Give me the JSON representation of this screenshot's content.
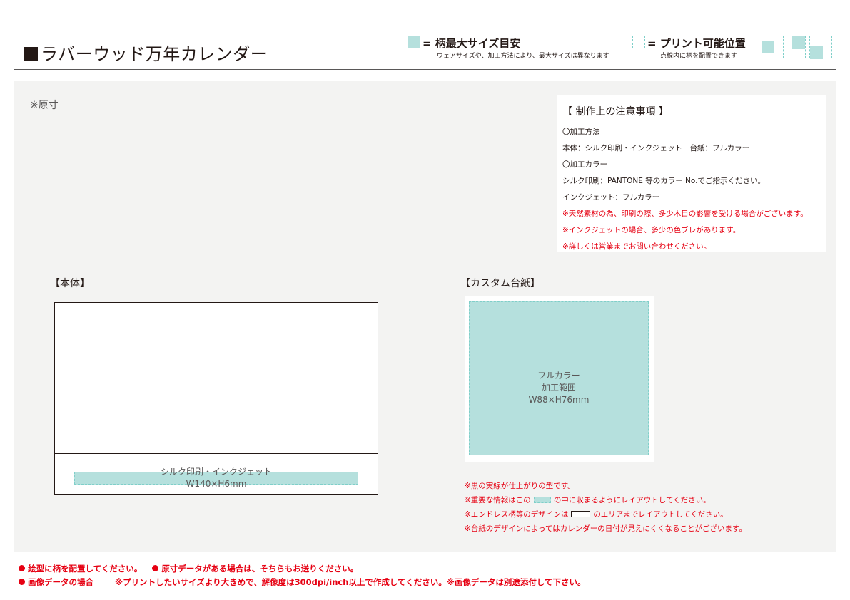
{
  "header": {
    "title": "ラバーウッド万年カレンダー",
    "legend_max": {
      "label": "= 柄最大サイズ目安",
      "sub": "ウェアサイズや、加工方法により、最大サイズは異なります"
    },
    "legend_position": {
      "label": "= プリント可能位置",
      "sub": "点線内に柄を配置できます"
    }
  },
  "main": {
    "scale_note": "※原寸",
    "notes": {
      "title": "【 制作上の注意事項 】",
      "lines": [
        "〇加工方法",
        "本体：シルク印刷・インクジェット　台紙：フルカラー",
        "〇加工カラー",
        "シルク印刷：PANTONE 等のカラー No.でご指示ください。",
        "インクジェット：フルカラー"
      ],
      "red_lines": [
        "※天然素材の為、印刷の際、多少木目の影響を受ける場合がございます。",
        "※インクジェットの場合、多少の色ブレがあります。",
        "※詳しくは営業までお問い合わせください。"
      ]
    },
    "body": {
      "label": "【本体】",
      "print_line1": "シルク印刷・インクジェット",
      "print_line2": "W140×H6mm"
    },
    "card": {
      "label": "【カスタム台紙】",
      "print_line1": "フルカラー",
      "print_line2": "加工範囲",
      "print_line3": "W88×H76mm",
      "note1": "※黒の実線が仕上がりの型です。",
      "note2_a": "※重要な情報はこの",
      "note2_b": "の中に収まるようにレイアウトしてください。",
      "note3_a": "※エンドレス柄等のデザインは",
      "note3_b": "のエリアまでレイアウトしてください。",
      "note4": "※台紙のデザインによってはカレンダーの日付が見えにくくなることがございます。"
    }
  },
  "footer": {
    "line1_a": "絵型に柄を配置してください。",
    "line1_b": "原寸データがある場合は、そちらもお送りください。",
    "line2_a": "画像データの場合",
    "line2_b": "※プリントしたいサイズより大きめで、解像度は300dpi/inch以上で作成してください。※画像データは別途添付して下さい。"
  },
  "colors": {
    "print_area": "#b5e0dd",
    "print_area_border": "#7fcfc9",
    "warning_red": "#e60012",
    "text": "#231815",
    "panel_bg": "#f3f3f2"
  }
}
